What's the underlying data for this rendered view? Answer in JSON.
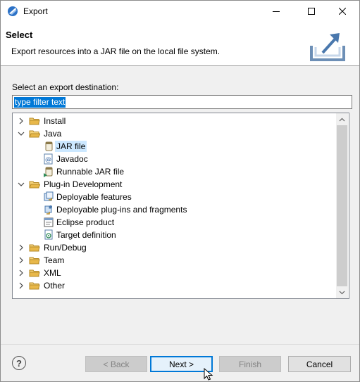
{
  "window": {
    "title": "Export"
  },
  "header": {
    "title": "Select",
    "description": "Export resources into a JAR file on the local file system."
  },
  "body": {
    "label": "Select an export destination:",
    "filter_value": "type filter text"
  },
  "tree": {
    "items": [
      {
        "label": "Install",
        "expanded": false
      },
      {
        "label": "Java",
        "expanded": true
      },
      {
        "label": "JAR file",
        "selected": true
      },
      {
        "label": "Javadoc"
      },
      {
        "label": "Runnable JAR file"
      },
      {
        "label": "Plug-in Development",
        "expanded": true
      },
      {
        "label": "Deployable features"
      },
      {
        "label": "Deployable plug-ins and fragments"
      },
      {
        "label": "Eclipse product"
      },
      {
        "label": "Target definition"
      },
      {
        "label": "Run/Debug",
        "expanded": false
      },
      {
        "label": "Team",
        "expanded": false
      },
      {
        "label": "XML",
        "expanded": false
      },
      {
        "label": "Other",
        "expanded": false
      }
    ]
  },
  "buttons": {
    "help": "?",
    "back": "< Back",
    "next": "Next >",
    "finish": "Finish",
    "cancel": "Cancel"
  },
  "colors": {
    "selection_highlight": "#0078d7",
    "tree_selection": "#cce8ff",
    "folder": "#e8b84a"
  }
}
